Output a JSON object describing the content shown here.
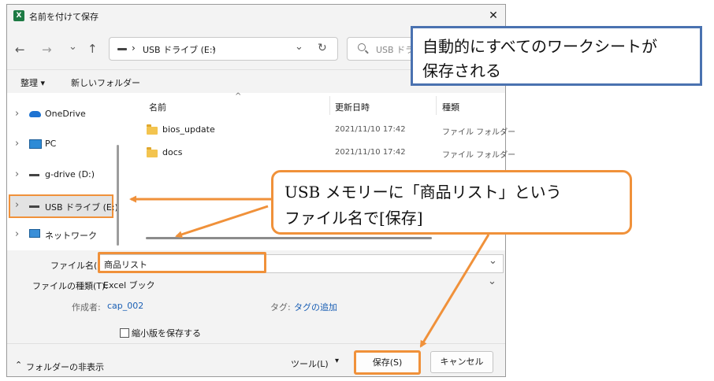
{
  "window": {
    "title": "名前を付けて保存",
    "app_icon_label": "X",
    "close_glyph": "✕"
  },
  "nav": {
    "back_glyph": "←",
    "forward_glyph": "→",
    "recent_glyph": "⌄",
    "up_glyph": "↑",
    "breadcrumb_sep1": "›",
    "breadcrumb_location": "USB ドライブ (E:)",
    "breadcrumb_sep2": "›",
    "dropdown_glyph": "⌄",
    "refresh_glyph": "↻",
    "search_placeholder": "USB ドラ"
  },
  "toolbar": {
    "organize_label": "整理 ▾",
    "new_folder_label": "新しいフォルダー"
  },
  "sidebar": {
    "items": [
      {
        "chevron": "›",
        "label": "OneDrive"
      },
      {
        "chevron": "›",
        "label": "PC"
      },
      {
        "chevron": "›",
        "label": "g-drive (D:)"
      },
      {
        "chevron": "›",
        "label": "USB ドライブ (E:)"
      },
      {
        "chevron": "›",
        "label": "ネットワーク"
      }
    ]
  },
  "file_list": {
    "columns": {
      "name": "名前",
      "sort_glyph": "^",
      "date": "更新日時",
      "type": "種類"
    },
    "rows": [
      {
        "name": "bios_update",
        "date": "2021/11/10 17:42",
        "type": "ファイル フォルダー"
      },
      {
        "name": "docs",
        "date": "2021/11/10 17:42",
        "type": "ファイル フォルダー"
      }
    ]
  },
  "form": {
    "filename_label": "ファイル名(N):",
    "filename_value": "商品リスト",
    "filetype_label": "ファイルの種類(T):",
    "filetype_value": "Excel ブック",
    "dropdown_glyph": "⌄",
    "author_label": "作成者:",
    "author_value": "cap_002",
    "tags_label": "タグ:",
    "tags_value": "タグの追加",
    "thumbnail_label": "縮小版を保存する"
  },
  "footer": {
    "hide_folders_label": "フォルダーの非表示",
    "hide_folders_glyph": "⌃",
    "tools_label": "ツール(L)",
    "tools_glyph": "▾",
    "save_label": "保存(S)",
    "cancel_label": "キャンセル"
  },
  "annotations": {
    "callout_top": {
      "line1": "自動的にすべてのワークシートが",
      "line2": "保存される"
    },
    "callout_mid": {
      "line1": "USB メモリーに「商品リスト」という",
      "line2": "ファイル名で[保存]"
    }
  },
  "colors": {
    "accent_orange": "#f0913a",
    "callout_blue_border": "#4a72b0",
    "excel_green": "#1d7a44",
    "link_blue": "#1a5fb4",
    "dialog_bg": "#f3f3f3"
  }
}
